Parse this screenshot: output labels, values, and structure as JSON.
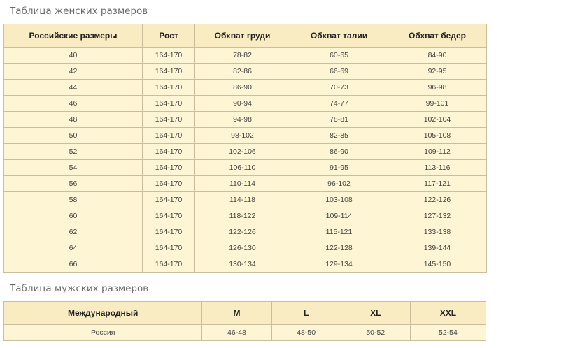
{
  "women": {
    "title": "Таблица женских размеров",
    "headers": [
      "Российские размеры",
      "Рост",
      "Обхват груди",
      "Обхват талии",
      "Обхват бедер"
    ],
    "rows": [
      [
        "40",
        "164-170",
        "78-82",
        "60-65",
        "84-90"
      ],
      [
        "42",
        "164-170",
        "82-86",
        "66-69",
        "92-95"
      ],
      [
        "44",
        "164-170",
        "86-90",
        "70-73",
        "96-98"
      ],
      [
        "46",
        "164-170",
        "90-94",
        "74-77",
        "99-101"
      ],
      [
        "48",
        "164-170",
        "94-98",
        "78-81",
        "102-104"
      ],
      [
        "50",
        "164-170",
        "98-102",
        "82-85",
        "105-108"
      ],
      [
        "52",
        "164-170",
        "102-106",
        "86-90",
        "109-112"
      ],
      [
        "54",
        "164-170",
        "106-110",
        "91-95",
        "113-116"
      ],
      [
        "56",
        "164-170",
        "110-114",
        "96-102",
        "117-121"
      ],
      [
        "58",
        "164-170",
        "114-118",
        "103-108",
        "122-126"
      ],
      [
        "60",
        "164-170",
        "118-122",
        "109-114",
        "127-132"
      ],
      [
        "62",
        "164-170",
        "122-126",
        "115-121",
        "133-138"
      ],
      [
        "64",
        "164-170",
        "126-130",
        "122-128",
        "139-144"
      ],
      [
        "66",
        "164-170",
        "130-134",
        "129-134",
        "145-150"
      ]
    ]
  },
  "men": {
    "title": "Таблица мужских размеров",
    "headers": [
      "Международный",
      "M",
      "L",
      "XL",
      "XXL"
    ],
    "rows": [
      [
        "Россия",
        "46-48",
        "48-50",
        "50-52",
        "52-54"
      ]
    ]
  },
  "colors": {
    "header_bg": "#f9ecc3",
    "cell_bg": "#fdf5d3",
    "border": "#c9bf9f",
    "title_text": "#6b6b6b"
  }
}
